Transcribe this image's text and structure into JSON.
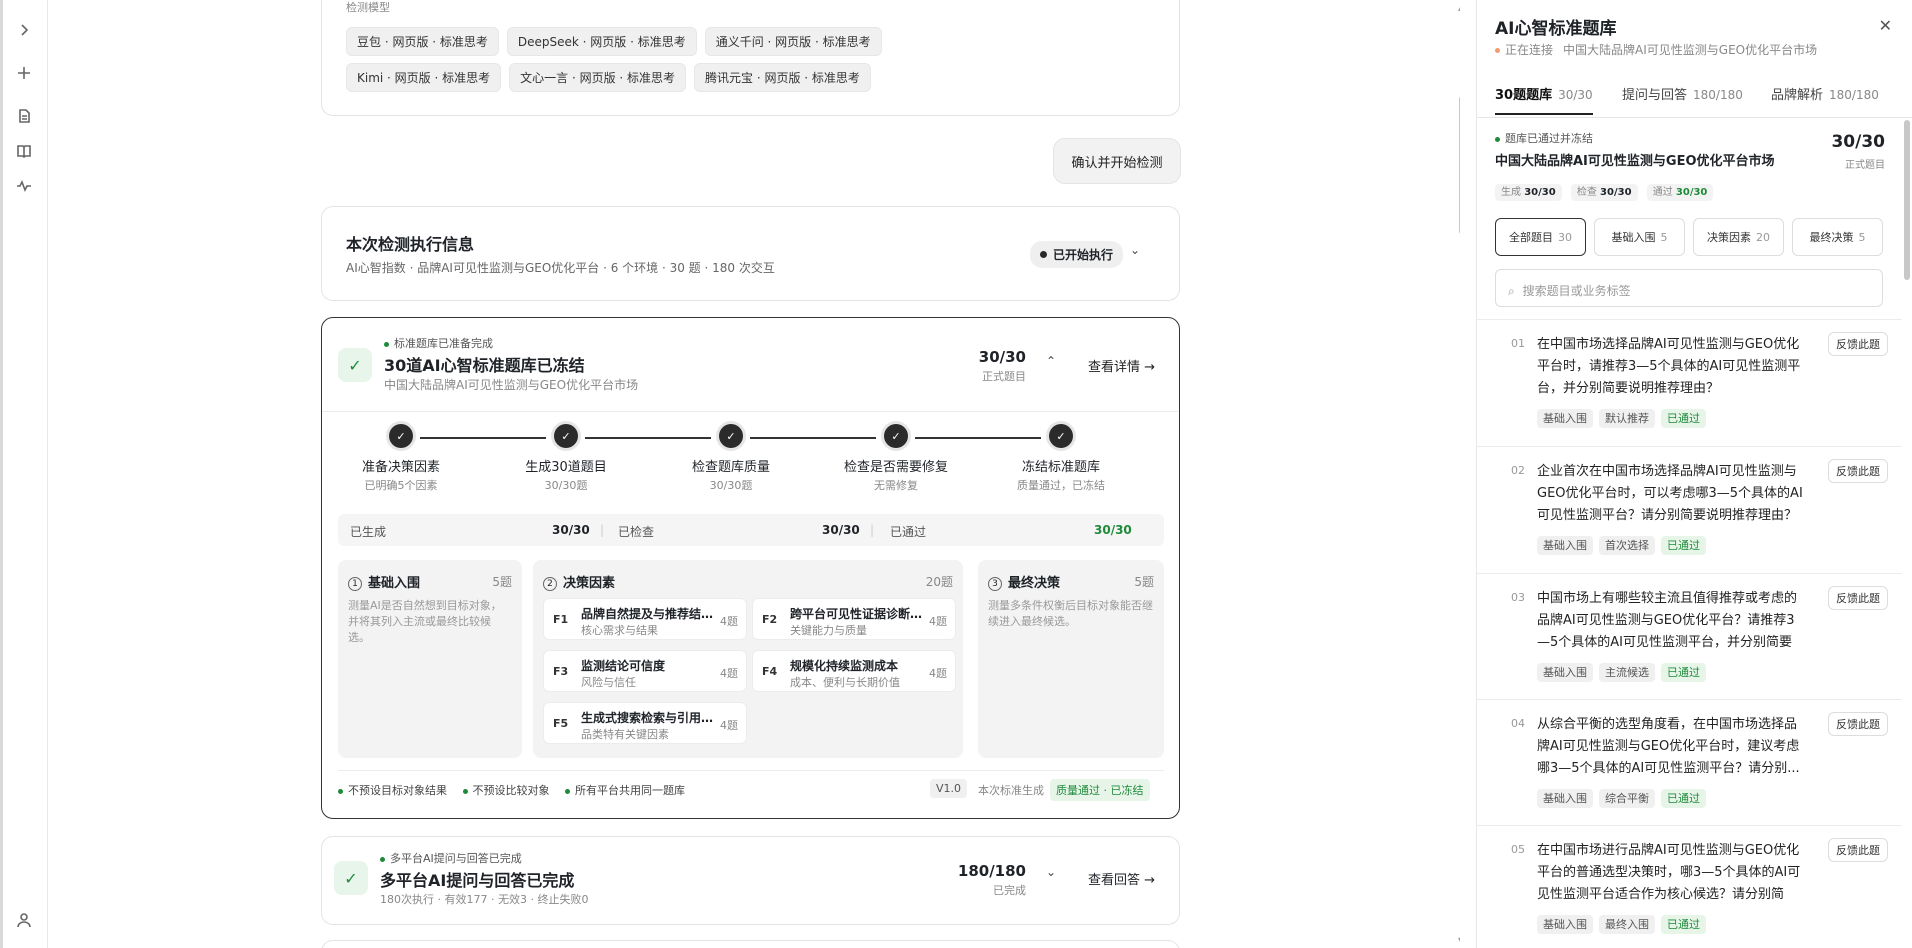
{
  "models_label": "检测模型",
  "models": [
    [
      "豆包 · 网页版 · 标准思考",
      "DeepSeek · 网页版 · 标准思考",
      "通义千问 · 网页版 · 标准思考"
    ],
    [
      "Kimi · 网页版 · 标准思考",
      "文心一言 · 网页版 · 标准思考",
      "腾讯元宝 · 网页版 · 标准思考"
    ]
  ],
  "confirm_button": "确认并开始检测",
  "exec": {
    "title": "本次检测执行信息",
    "subtitle": "AI心智指数 · 品牌AI可见性监测与GEO优化平台 · 6 个环境 · 30 题 · 180 次交互",
    "badge": "已开始执行"
  },
  "bank": {
    "status": "标准题库已准备完成",
    "title": "30道AI心智标准题库已冻结",
    "subtitle": "中国大陆品牌AI可见性监测与GEO优化平台市场",
    "count": "30/30",
    "count_label": "正式题目",
    "details": "查看详情 →",
    "steps": [
      {
        "title": "准备决策因素",
        "sub": "已明确5个因素"
      },
      {
        "title": "生成30道题目",
        "sub": "30/30题"
      },
      {
        "title": "检查题库质量",
        "sub": "30/30题"
      },
      {
        "title": "检查是否需要修复",
        "sub": "无需修复"
      },
      {
        "title": "冻结标准题库",
        "sub": "质量通过，已冻结"
      }
    ],
    "stats": [
      {
        "label": "已生成",
        "value": "30/30"
      },
      {
        "label": "已检查",
        "value": "30/30"
      },
      {
        "label": "已通过",
        "value": "30/30"
      }
    ],
    "panel1": {
      "num": "1",
      "title": "基础入围",
      "count": "5题",
      "desc": "测量AI是否自然想到目标对象，并将其列入主流或最终比较候选。"
    },
    "panel2": {
      "num": "2",
      "title": "决策因素",
      "count": "20题"
    },
    "factors": [
      {
        "id": "F1",
        "title": "品牌自然提及与推荐结…",
        "sub": "核心需求与结果",
        "count": "4题"
      },
      {
        "id": "F2",
        "title": "跨平台可见性证据诊断…",
        "sub": "关键能力与质量",
        "count": "4题"
      },
      {
        "id": "F3",
        "title": "监测结论可信度",
        "sub": "风险与信任",
        "count": "4题"
      },
      {
        "id": "F4",
        "title": "规模化持续监测成本",
        "sub": "成本、便利与长期价值",
        "count": "4题"
      },
      {
        "id": "F5",
        "title": "生成式搜索检索与引用…",
        "sub": "品类特有关键因素",
        "count": "4题"
      }
    ],
    "panel3": {
      "num": "3",
      "title": "最终决策",
      "count": "5题",
      "desc": "测量多条件权衡后目标对象能否继续进入最终候选。"
    },
    "footer_notes": [
      "不预设目标对象结果",
      "不预设比较对象",
      "所有平台共用同一题库"
    ],
    "version": "V1.0",
    "gen_label": "本次标准生成",
    "quality_tag": "质量通过 · 已冻结"
  },
  "qa": {
    "status": "多平台AI提问与回答已完成",
    "title": "多平台AI提问与回答已完成",
    "subtitle": "180次执行 · 有效177 · 无效3 · 终止失败0",
    "count": "180/180",
    "count_label": "已完成",
    "link": "查看回答 →"
  },
  "panel": {
    "title": "AI心智标准题库",
    "status": "正在连接",
    "market": "中国大陆品牌AI可见性监测与GEO优化平台市场",
    "tabs": [
      {
        "label": "30题题库",
        "count": "30/30"
      },
      {
        "label": "提问与回答",
        "count": "180/180"
      },
      {
        "label": "品牌解析",
        "count": "180/180"
      }
    ],
    "summary": {
      "status": "题库已通过并冻结",
      "title": "中国大陆品牌AI可见性监测与GEO优化平台市场",
      "count": "30/30",
      "count_label": "正式题目",
      "metrics": [
        {
          "label": "生成",
          "value": "30/30"
        },
        {
          "label": "检查",
          "value": "30/30"
        },
        {
          "label": "通过",
          "value": "30/30"
        }
      ]
    },
    "filters": [
      {
        "label": "全部题目",
        "count": "30"
      },
      {
        "label": "基础入围",
        "count": "5"
      },
      {
        "label": "决策因素",
        "count": "20"
      },
      {
        "label": "最终决策",
        "count": "5"
      }
    ],
    "search_placeholder": "搜索题目或业务标签",
    "feedback_label": "反馈此题",
    "questions": [
      {
        "no": "01",
        "text": "在中国市场选择品牌AI可见性监测与GEO优化平台时，请推荐3—5个具体的AI可见性监测平台，并分别简要说明推荐理由？",
        "tags": [
          "基础入围",
          "默认推荐",
          "已通过"
        ]
      },
      {
        "no": "02",
        "text": "企业首次在中国市场选择品牌AI可见性监测与GEO优化平台时，可以考虑哪3—5个具体的AI可见性监测平台？请分别简要说明推荐理由？",
        "tags": [
          "基础入围",
          "首次选择",
          "已通过"
        ]
      },
      {
        "no": "03",
        "text": "中国市场上有哪些较主流且值得推荐或考虑的品牌AI可见性监测与GEO优化平台？请推荐3—5个具体的AI可见性监测平台，并分别简要说...",
        "tags": [
          "基础入围",
          "主流候选",
          "已通过"
        ]
      },
      {
        "no": "04",
        "text": "从综合平衡的选型角度看，在中国市场选择品牌AI可见性监测与GEO优化平台时，建议考虑哪3—5个具体的AI可见性监测平台？请分别...",
        "tags": [
          "基础入围",
          "综合平衡",
          "已通过"
        ]
      },
      {
        "no": "05",
        "text": "在中国市场进行品牌AI可见性监测与GEO优化平台的普通选型决策时，哪3—5个具体的AI可见性监测平台适合作为核心候选？请分别简要...",
        "tags": [
          "基础入围",
          "最终入围",
          "已通过"
        ]
      }
    ]
  },
  "colors": {
    "accent_green": "#1f8a3a",
    "dark": "#2b2b2b"
  }
}
